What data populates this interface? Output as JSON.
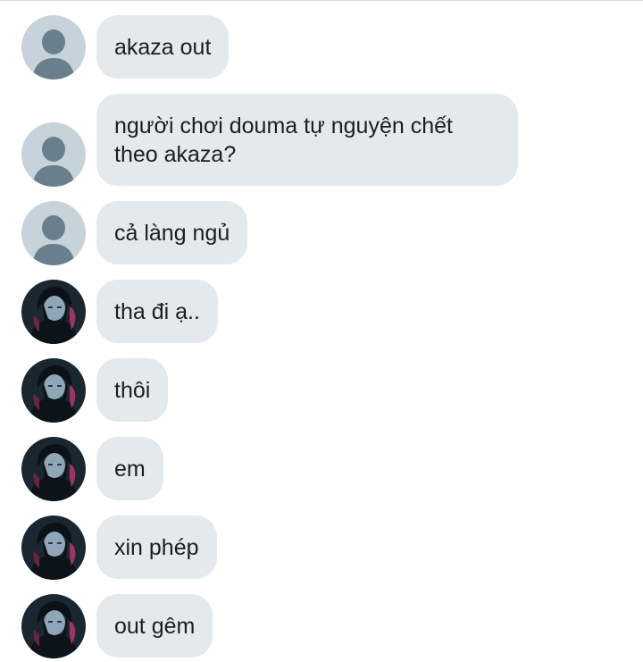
{
  "avatars": {
    "default": {
      "icon": "default-profile-icon",
      "bg": "#c7d3da",
      "fg": "#6a7f8e"
    },
    "photo": {
      "icon": "anime-character-avatar-icon",
      "bg": "#1a2730",
      "accent": "#9b3561"
    }
  },
  "colors": {
    "bubble": "#e4e9ed",
    "text": "#1b1e21"
  },
  "messages": [
    {
      "avatar": "default",
      "text": "akaza out"
    },
    {
      "avatar": "default",
      "text": "người chơi douma tự nguyện chết theo akaza?"
    },
    {
      "avatar": "default",
      "text": "cả làng ngủ"
    },
    {
      "avatar": "photo",
      "text": "tha đi ạ.."
    },
    {
      "avatar": "photo",
      "text": "thôi"
    },
    {
      "avatar": "photo",
      "text": "em"
    },
    {
      "avatar": "photo",
      "text": "xin phép"
    },
    {
      "avatar": "photo",
      "text": "out gêm"
    }
  ]
}
